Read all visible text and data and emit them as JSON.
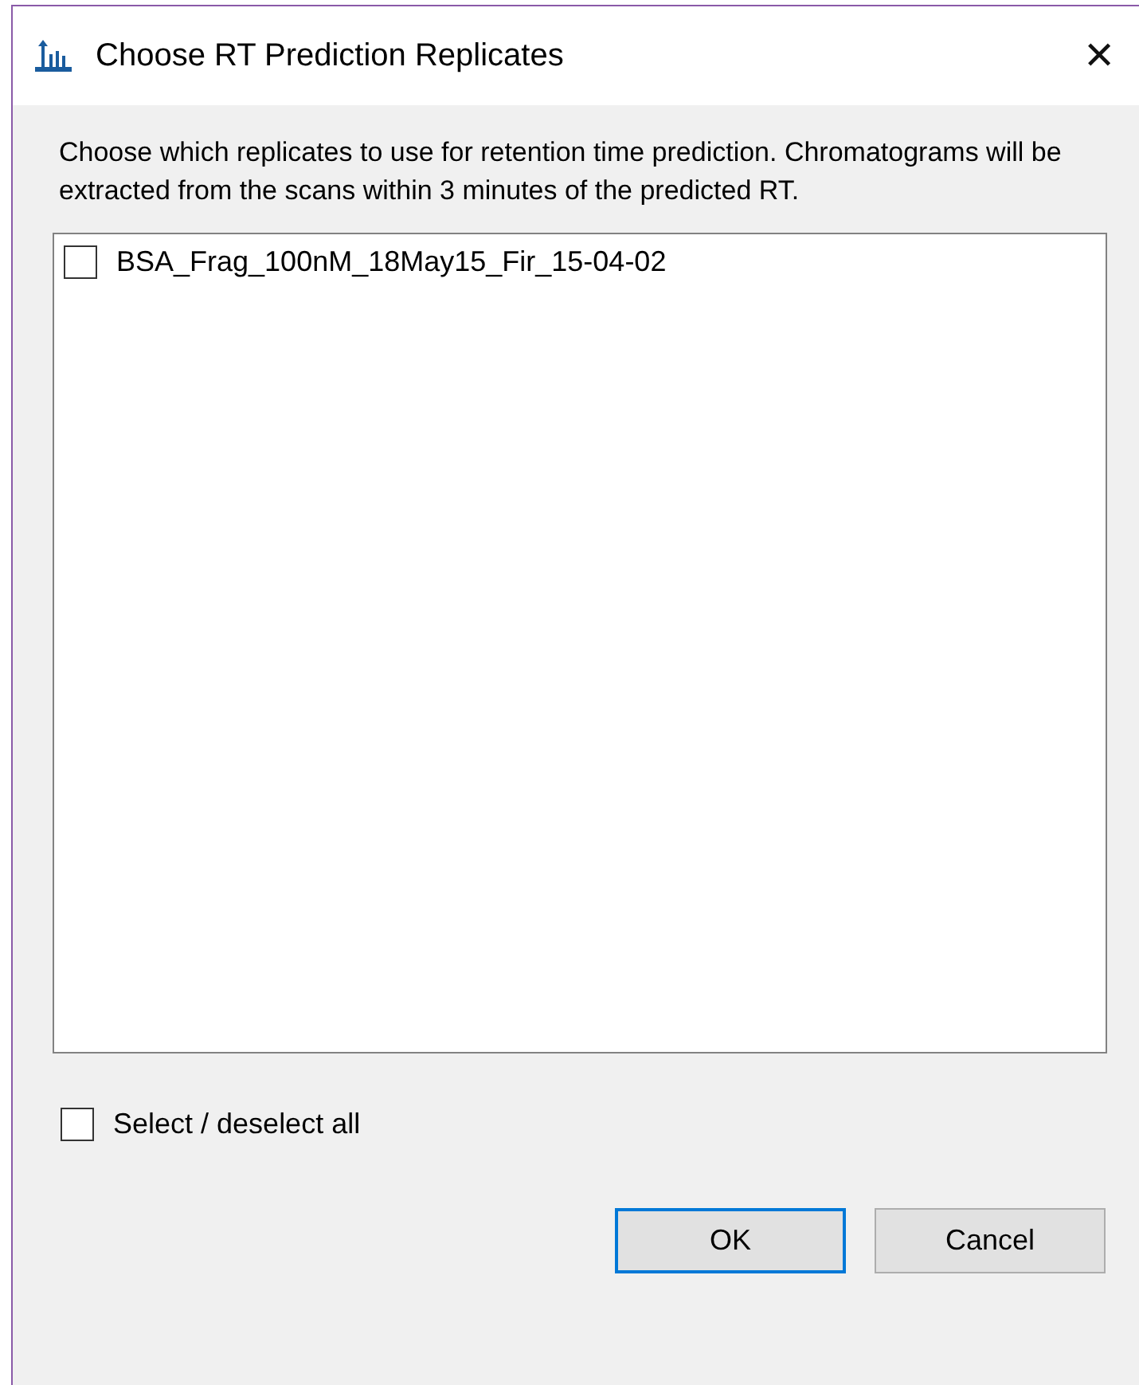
{
  "window": {
    "title": "Choose RT Prediction Replicates",
    "close": "✕"
  },
  "description": "Choose which replicates to use for retention time prediction. Chromatograms will be extracted from the scans within 3 minutes of the predicted RT.",
  "replicates": [
    {
      "label": "BSA_Frag_100nM_18May15_Fir_15-04-02",
      "checked": false
    }
  ],
  "select_all": {
    "label": "Select / deselect all",
    "checked": false
  },
  "buttons": [
    {
      "label": "OK",
      "default": true
    },
    {
      "label": "Cancel",
      "default": false
    }
  ]
}
